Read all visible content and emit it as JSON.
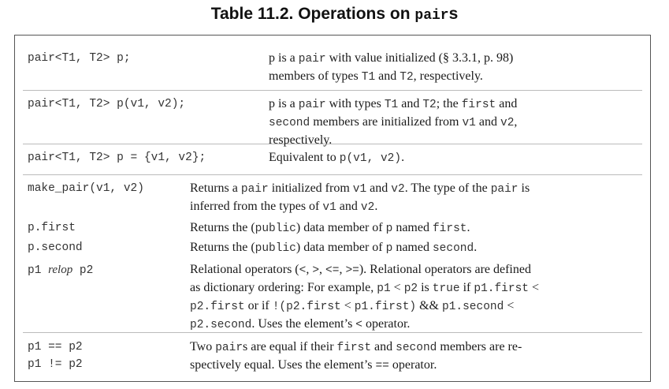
{
  "title": {
    "prefix": "Table 11.2. Operations on ",
    "code": "pair",
    "suffix": "s"
  },
  "rows": [
    {
      "code_lines": [
        "pair<T1, T2> p;"
      ],
      "desc_lines": [
        [
          [
            "t",
            "p"
          ],
          [
            "t",
            " is a "
          ],
          [
            "m",
            "pair"
          ],
          [
            "t",
            " with value initialized (§ 3.3.1, p. 98)"
          ]
        ],
        [
          [
            "t",
            "members of types "
          ],
          [
            "m",
            "T1"
          ],
          [
            "t",
            " and "
          ],
          [
            "m",
            "T2"
          ],
          [
            "t",
            ", respectively."
          ]
        ]
      ]
    },
    {
      "code_lines": [
        "pair<T1, T2> p(v1, v2);"
      ],
      "desc_lines": [
        [
          [
            "t",
            "p"
          ],
          [
            "t",
            " is a "
          ],
          [
            "m",
            "pair"
          ],
          [
            "t",
            " with types "
          ],
          [
            "m",
            "T1"
          ],
          [
            "t",
            " and "
          ],
          [
            "m",
            "T2"
          ],
          [
            "t",
            "; the "
          ],
          [
            "m",
            "first"
          ],
          [
            "t",
            " and"
          ]
        ],
        [
          [
            "m",
            "second"
          ],
          [
            "t",
            " members are initialized from "
          ],
          [
            "m",
            "v1"
          ],
          [
            "t",
            " and "
          ],
          [
            "m",
            "v2"
          ],
          [
            "t",
            ","
          ]
        ],
        [
          [
            "t",
            "respectively."
          ]
        ]
      ]
    },
    {
      "code_lines": [
        "pair<T1, T2> p = {v1, v2};"
      ],
      "desc_lines": [
        [
          [
            "t",
            "Equivalent to "
          ],
          [
            "m",
            "p(v1, v2)"
          ],
          [
            "t",
            "."
          ]
        ]
      ]
    },
    {
      "code_lines": [
        "make_pair(v1, v2)"
      ],
      "desc_lines": [
        [
          [
            "t",
            "Returns a "
          ],
          [
            "m",
            "pair"
          ],
          [
            "t",
            " initialized from "
          ],
          [
            "m",
            "v1"
          ],
          [
            "t",
            " and "
          ],
          [
            "m",
            "v2"
          ],
          [
            "t",
            ". The type of the "
          ],
          [
            "m",
            "pair"
          ],
          [
            "t",
            " is"
          ]
        ],
        [
          [
            "t",
            "inferred from the types of "
          ],
          [
            "m",
            "v1"
          ],
          [
            "t",
            " and "
          ],
          [
            "m",
            "v2"
          ],
          [
            "t",
            "."
          ]
        ]
      ]
    },
    {
      "code_lines": [
        "p.first"
      ],
      "desc_lines": [
        [
          [
            "t",
            "Returns the ("
          ],
          [
            "m",
            "public"
          ],
          [
            "t",
            ") data member of "
          ],
          [
            "m",
            "p"
          ],
          [
            "t",
            " named "
          ],
          [
            "m",
            "first"
          ],
          [
            "t",
            "."
          ]
        ]
      ]
    },
    {
      "code_lines": [
        "p.second"
      ],
      "desc_lines": [
        [
          [
            "t",
            "Returns the ("
          ],
          [
            "m",
            "public"
          ],
          [
            "t",
            ") data member of "
          ],
          [
            "m",
            "p"
          ],
          [
            "t",
            " named "
          ],
          [
            "m",
            "second"
          ],
          [
            "t",
            "."
          ]
        ]
      ]
    },
    {
      "code_lines": [
        [
          [
            "m",
            "p1 "
          ],
          [
            "i",
            "relop"
          ],
          [
            "m",
            " p2"
          ]
        ]
      ],
      "desc_lines": [
        [
          [
            "t",
            "Relational operators ("
          ],
          [
            "m",
            "<"
          ],
          [
            "t",
            ", "
          ],
          [
            "m",
            ">"
          ],
          [
            "t",
            ", "
          ],
          [
            "m",
            "<="
          ],
          [
            "t",
            ", "
          ],
          [
            "m",
            ">="
          ],
          [
            "t",
            "). Relational operators are defined"
          ]
        ],
        [
          [
            "t",
            "as dictionary ordering: For example, "
          ],
          [
            "m",
            "p1"
          ],
          [
            "t",
            " < "
          ],
          [
            "m",
            "p2"
          ],
          [
            "t",
            " is "
          ],
          [
            "m",
            "true"
          ],
          [
            "t",
            " if "
          ],
          [
            "m",
            "p1.first"
          ],
          [
            "t",
            " <"
          ]
        ],
        [
          [
            "m",
            "p2.first"
          ],
          [
            "t",
            " or if "
          ],
          [
            "m",
            "!(p2.first"
          ],
          [
            "t",
            " < "
          ],
          [
            "m",
            "p1.first)"
          ],
          [
            "t",
            " && "
          ],
          [
            "m",
            "p1.second"
          ],
          [
            "t",
            " <"
          ]
        ],
        [
          [
            "m",
            "p2.second"
          ],
          [
            "t",
            ". Uses the element’s "
          ],
          [
            "m",
            "<"
          ],
          [
            "t",
            " operator."
          ]
        ]
      ]
    },
    {
      "code_lines": [
        "p1 == p2",
        "p1 != p2"
      ],
      "desc_lines": [
        [
          [
            "t",
            "Two "
          ],
          [
            "m",
            "pair"
          ],
          [
            "t",
            "s are equal if their "
          ],
          [
            "m",
            "first"
          ],
          [
            "t",
            " and "
          ],
          [
            "m",
            "second"
          ],
          [
            "t",
            " members are re-"
          ]
        ],
        [
          [
            "t",
            "spectively equal. Uses the element’s "
          ],
          [
            "m",
            "=="
          ],
          [
            "t",
            " operator."
          ]
        ]
      ]
    }
  ]
}
